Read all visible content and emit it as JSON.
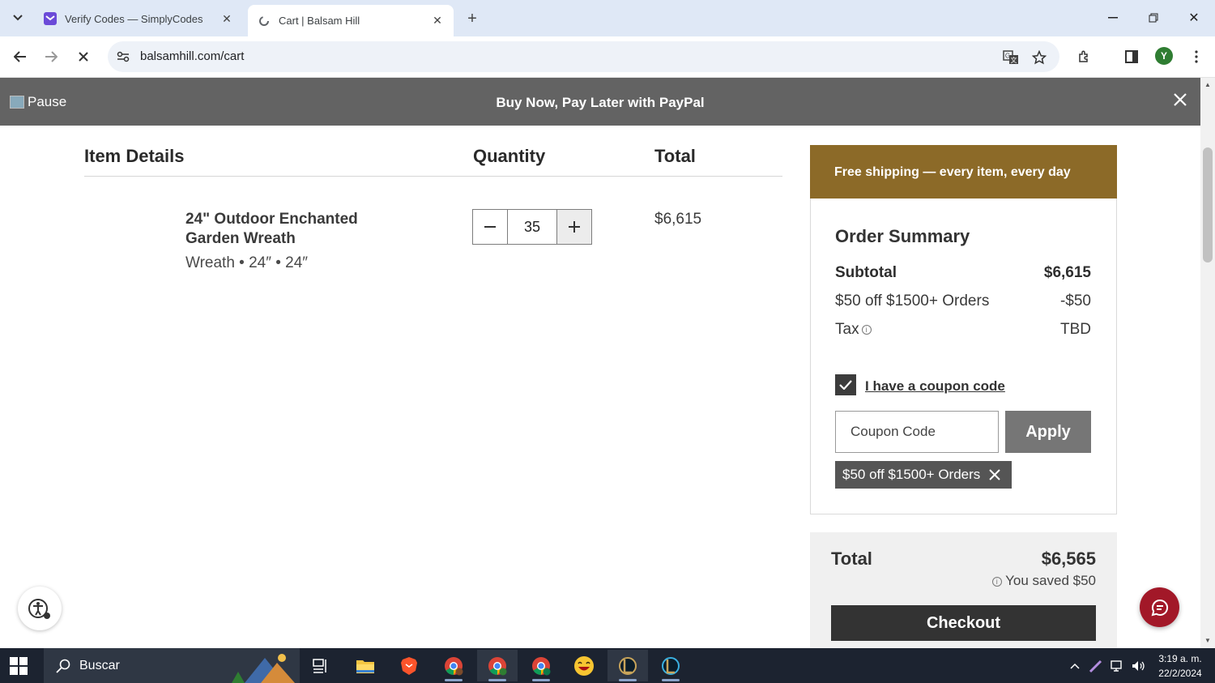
{
  "browser": {
    "tabs": [
      {
        "title": "Verify Codes — SimplyCodes",
        "icon": "simplycodes-icon",
        "active": false
      },
      {
        "title": "Cart | Balsam Hill",
        "icon": "loading-icon",
        "active": true
      }
    ],
    "url": "balsamhill.com/cart",
    "profile_initial": "Y"
  },
  "promo": {
    "pause_label": "Pause",
    "message": "Buy Now, Pay Later with PayPal"
  },
  "cart": {
    "headers": {
      "item": "Item Details",
      "quantity": "Quantity",
      "total": "Total"
    },
    "items": [
      {
        "name": "24\" Outdoor Enchanted Garden Wreath",
        "meta": "Wreath • 24″ • 24″",
        "quantity": "35",
        "total": "$6,615"
      }
    ]
  },
  "summary": {
    "shipping_banner": "Free shipping — every item, every day",
    "title": "Order Summary",
    "rows": [
      {
        "label": "Subtotal",
        "value": "$6,615"
      },
      {
        "label": "$50 off $1500+ Orders",
        "value": "-$50"
      },
      {
        "label": "Tax",
        "value": "TBD"
      }
    ],
    "coupon": {
      "checkbox_label": "I have a coupon code",
      "checked": true,
      "input_placeholder": "Coupon Code",
      "apply_label": "Apply",
      "applied_tag": "$50 off $1500+ Orders"
    },
    "total_label": "Total",
    "total_value": "$6,565",
    "saved_text": "You saved $50",
    "checkout_label": "Checkout"
  },
  "taskbar": {
    "search_text": "Buscar",
    "time": "3:19 a. m.",
    "date": "22/2/2024"
  },
  "colors": {
    "promo_bg": "#636363",
    "shipping_banner_bg": "#8c6a28",
    "checkout_bg": "#333333",
    "chat_bg": "#a21828"
  }
}
